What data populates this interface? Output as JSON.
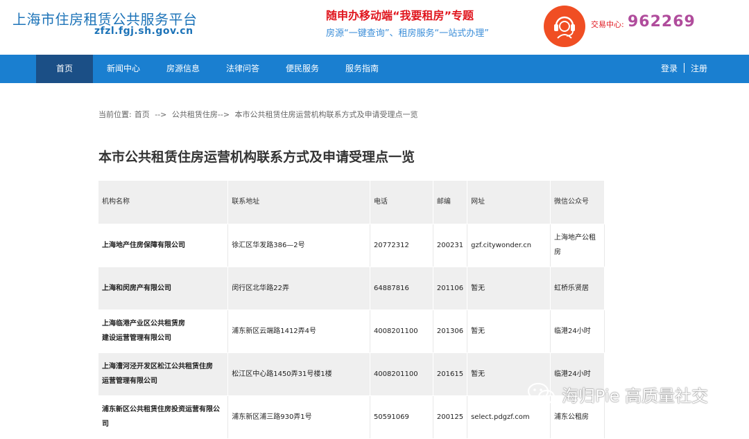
{
  "header": {
    "site_title": "上海市住房租赁公共服务平台",
    "site_domain": "zfzl.fgj.sh.gov.cn",
    "promo_title": "随申办移动端“我要租房”专题",
    "promo_subtitle": "房源“一键查询”、租房服务“一站式办理”",
    "hotline_label": "交易中心:",
    "hotline_number": "962269",
    "hotline_icon": "headset-agent-icon"
  },
  "nav": {
    "items": [
      {
        "label": "首页",
        "active": true
      },
      {
        "label": "新闻中心"
      },
      {
        "label": "房源信息"
      },
      {
        "label": "法律问答"
      },
      {
        "label": "便民服务"
      },
      {
        "label": "服务指南"
      }
    ],
    "login_label": "登录",
    "register_label": "注册"
  },
  "breadcrumb": {
    "prefix": "当前位置:",
    "items": [
      "首页",
      "-->",
      "公共租赁住房-->",
      "本市公共租赁住房运营机构联系方式及申请受理点一览"
    ]
  },
  "page_title": "本市公共租赁住房运营机构联系方式及申请受理点一览",
  "table": {
    "headers": [
      "机构名称",
      "联系地址",
      "电话",
      "邮编",
      "网址",
      "微信公众号"
    ],
    "rows": [
      {
        "name": "上海地产住房保障有限公司",
        "address": "徐汇区华发路386—2号",
        "phone": "20772312",
        "zip": "200231",
        "url": "gzf.citywonder.cn",
        "wechat": "上海地产公租房"
      },
      {
        "name": "上海和闵房产有限公司",
        "address": "闵行区北华路22弄",
        "phone": "64887816",
        "zip": "201106",
        "url": "暂无",
        "wechat": "虹桥乐贤居"
      },
      {
        "name_line1": "上海临港产业区公共租赁房",
        "name_line2": "建设运营管理有限公司",
        "address": "浦东新区云端路1412弄4号",
        "phone": "4008201100",
        "zip": "201306",
        "url": "暂无",
        "wechat": "临港24小时"
      },
      {
        "name_line1": "上海漕河泾开发区松江公共租赁住房",
        "name_line2": "运营管理有限公司",
        "address": "松江区中心路1450弄31号楼1楼",
        "phone": "4008201100",
        "zip": "201615",
        "url": "暂无",
        "wechat": "临港24小时"
      },
      {
        "name": "浦东新区公共租赁住房投资运营有限公司",
        "address": "浦东新区浦三路930弄1号",
        "phone": "50591069",
        "zip": "200125",
        "url": "select.pdgzf.com",
        "wechat": "浦东公租房"
      }
    ]
  },
  "watermark": {
    "text": "海归Pie 高质量社交",
    "icon": "wechat-icon"
  },
  "colors": {
    "brand_blue": "#1c73b8",
    "nav_blue": "#1a7fd0",
    "nav_active": "#1b4f86",
    "promo_red": "#e0161e",
    "hotline_orange": "#f04e23",
    "hotline_number": "#b04c9c"
  }
}
